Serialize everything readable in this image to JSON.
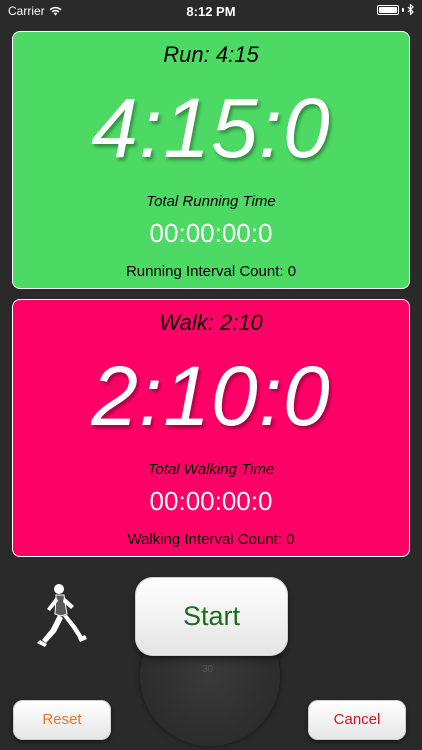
{
  "status_bar": {
    "carrier": "Carrier",
    "time": "8:12 PM",
    "icons": [
      "wifi-icon",
      "bluetooth-icon",
      "battery-icon"
    ]
  },
  "run_panel": {
    "title": "Run:  4:15",
    "clock": "4:15:0",
    "total_label": "Total Running Time",
    "total_value": "00:00:00:0",
    "count_label": "Running Interval Count: 0",
    "color": "#4cd964"
  },
  "walk_panel": {
    "title": "Walk:  2:10",
    "clock": "2:10:0",
    "total_label": "Total Walking Time",
    "total_value": "00:00:00:0",
    "count_label": "Walking Interval Count: 0",
    "color": "#ff0066"
  },
  "controls": {
    "start_label": "Start",
    "reset_label": "Reset",
    "cancel_label": "Cancel",
    "start_color": "#1e6b1e",
    "reset_color": "#e87722",
    "cancel_color": "#e0102a"
  },
  "stopwatch_dial": {
    "numbers": [
      "30"
    ]
  }
}
